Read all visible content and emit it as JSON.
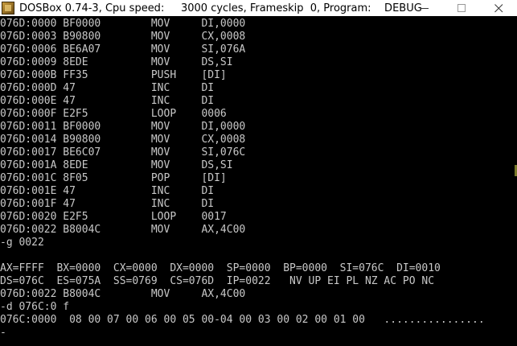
{
  "window": {
    "title": "DOSBox 0.74-3, Cpu speed:     3000 cycles, Frameskip  0, Program:    DEBUG",
    "icon": "dosbox-icon",
    "controls": [
      "minimize-icon",
      "maximize-icon",
      "close-icon"
    ]
  },
  "console": {
    "lines": [
      "076D:0000 BF0000        MOV     DI,0000",
      "076D:0003 B90800        MOV     CX,0008",
      "076D:0006 BE6A07        MOV     SI,076A",
      "076D:0009 8EDE          MOV     DS,SI",
      "076D:000B FF35          PUSH    [DI]",
      "076D:000D 47            INC     DI",
      "076D:000E 47            INC     DI",
      "076D:000F E2F5          LOOP    0006",
      "076D:0011 BF0000        MOV     DI,0000",
      "076D:0014 B90800        MOV     CX,0008",
      "076D:0017 BE6C07        MOV     SI,076C",
      "076D:001A 8EDE          MOV     DS,SI",
      "076D:001C 8F05          POP     [DI]",
      "076D:001E 47            INC     DI",
      "076D:001F 47            INC     DI",
      "076D:0020 E2F5          LOOP    0017",
      "076D:0022 B8004C        MOV     AX,4C00",
      "-g 0022",
      "",
      "AX=FFFF  BX=0000  CX=0000  DX=0000  SP=0000  BP=0000  SI=076C  DI=0010",
      "DS=076C  ES=075A  SS=0769  CS=076D  IP=0022   NV UP EI PL NZ AC PO NC",
      "076D:0022 B8004C        MOV     AX,4C00",
      "-d 076C:0 f",
      "076C:0000  08 00 07 00 06 00 05 00-04 00 03 00 02 00 01 00   ................",
      "-"
    ]
  }
}
